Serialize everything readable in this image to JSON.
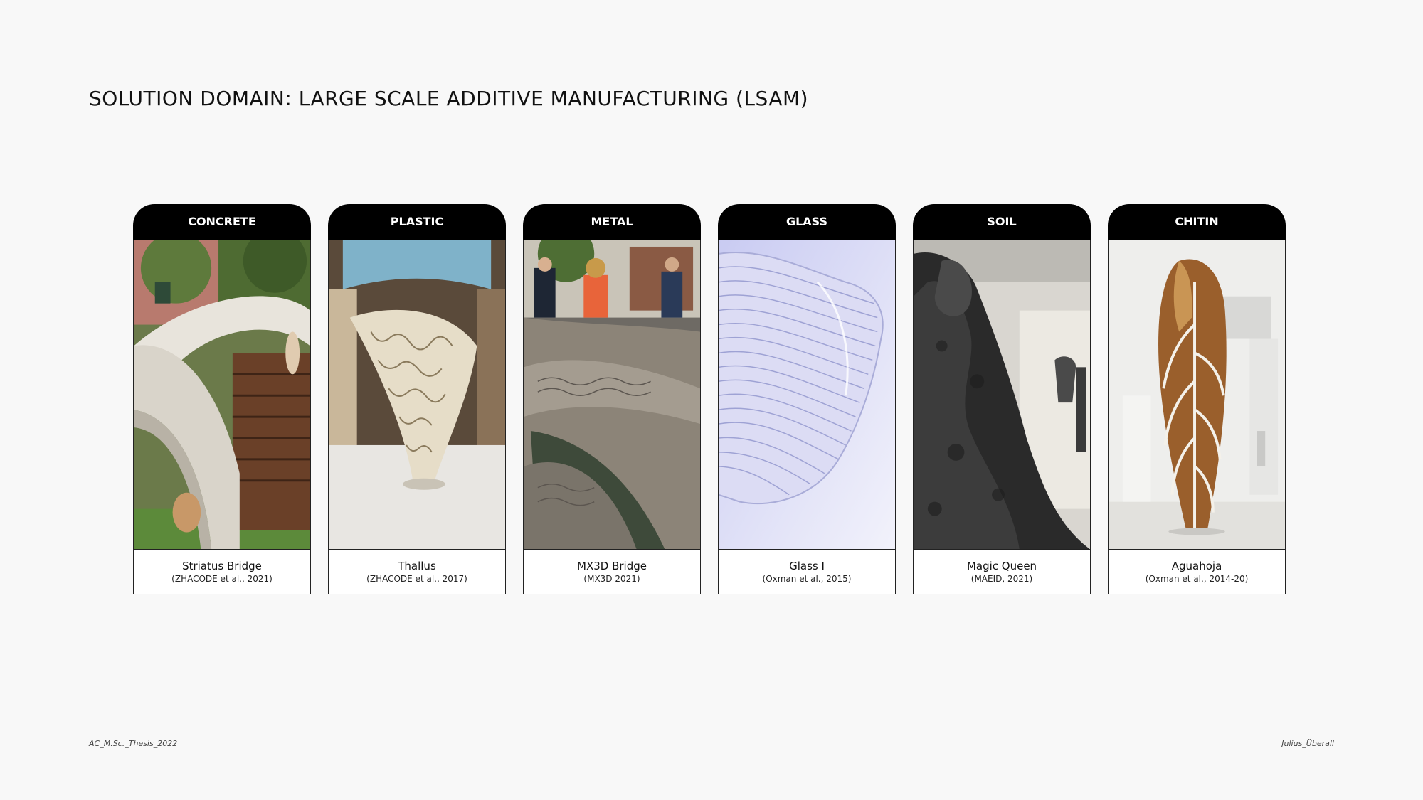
{
  "title": "SOLUTION DOMAIN: LARGE SCALE ADDITIVE MANUFACTURING (LSAM)",
  "cards": [
    {
      "material": "CONCRETE",
      "name": "Striatus Bridge",
      "ref": "(ZHACODE et al., 2021)"
    },
    {
      "material": "PLASTIC",
      "name": "Thallus",
      "ref": "(ZHACODE et al., 2017)"
    },
    {
      "material": "METAL",
      "name": "MX3D Bridge",
      "ref": "(MX3D 2021)"
    },
    {
      "material": "GLASS",
      "name": "Glass I",
      "ref": "(Oxman et al., 2015)"
    },
    {
      "material": "SOIL",
      "name": "Magic Queen",
      "ref": "(MAEID, 2021)"
    },
    {
      "material": "CHITIN",
      "name": "Aguahoja",
      "ref": "(Oxman et al., 2014-20)"
    }
  ],
  "footer": {
    "left": "AC_M.Sc._Thesis_2022",
    "right": "Julius_Überall"
  }
}
